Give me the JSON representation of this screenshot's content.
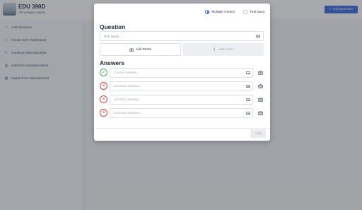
{
  "header": {
    "title": "EDU 390D",
    "subtitle": "All changes saved...",
    "add_question_label": "Add Question",
    "add_question_icon": "plus-icon"
  },
  "sidebar": {
    "items": [
      {
        "label": "Add Question",
        "icon": "plus-icon"
      },
      {
        "label": "Create with Flashcards",
        "icon": "cards-icon"
      },
      {
        "label": "Continue with KitCollab",
        "icon": "pencil-icon"
      },
      {
        "label": "Add from Question Bank",
        "icon": "bank-icon"
      },
      {
        "label": "Import from Spreadsheet",
        "icon": "spreadsheet-icon"
      }
    ]
  },
  "modal": {
    "question_type": {
      "options": [
        "Multiple Choice",
        "Text Input"
      ],
      "selected": "Multiple Choice"
    },
    "question_heading": "Question",
    "question_placeholder": "Ask away...",
    "add_photo_label": "Add Photo",
    "add_audio_label": "Add Audio",
    "answers_heading": "Answers",
    "answers": [
      {
        "placeholder": "Correct answer...",
        "correct": true
      },
      {
        "placeholder": "Incorrect answer...",
        "correct": false
      },
      {
        "placeholder": "Incorrect answer...",
        "correct": false
      },
      {
        "placeholder": "Incorrect answer...",
        "correct": false
      }
    ],
    "submit_label": "Add"
  },
  "colors": {
    "accent": "#2f62d9",
    "correct": "#3fa84a",
    "incorrect": "#d8413a"
  }
}
